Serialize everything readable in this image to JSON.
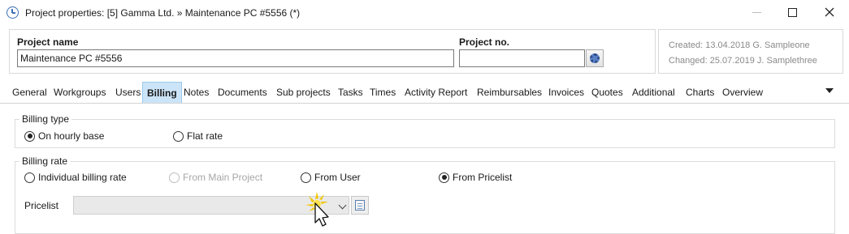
{
  "window": {
    "title": "Project properties: [5] Gamma Ltd. » Maintenance PC #5556 (*)",
    "controls": {
      "minimize": "minimize-icon",
      "maximize": "maximize-icon",
      "close": "close-icon"
    }
  },
  "header": {
    "project_name_label": "Project name",
    "project_name_value": "Maintenance PC #5556",
    "project_no_label": "Project no.",
    "project_no_value": "",
    "created": "Created: 13.04.2018 G. Sampleone",
    "changed": "Changed: 25.07.2019 J. Samplethree"
  },
  "tabs": [
    {
      "label": "General"
    },
    {
      "label": "Workgroups"
    },
    {
      "label": "Users"
    },
    {
      "label": "Billing"
    },
    {
      "label": "Notes"
    },
    {
      "label": "Documents"
    },
    {
      "label": "Sub projects"
    },
    {
      "label": "Tasks"
    },
    {
      "label": "Times"
    },
    {
      "label": "Activity Report"
    },
    {
      "label": "Reimbursables"
    },
    {
      "label": "Invoices"
    },
    {
      "label": "Quotes"
    },
    {
      "label": "Additional"
    },
    {
      "label": "Charts"
    },
    {
      "label": "Overview"
    }
  ],
  "active_tab": "Billing",
  "billing_type": {
    "title": "Billing type",
    "options": [
      {
        "label": "On hourly base",
        "checked": true
      },
      {
        "label": "Flat rate",
        "checked": false
      }
    ]
  },
  "billing_rate": {
    "title": "Billing rate",
    "options": [
      {
        "label": "Individual billing rate",
        "checked": false,
        "enabled": true
      },
      {
        "label": "From Main Project",
        "checked": false,
        "enabled": false
      },
      {
        "label": "From User",
        "checked": false,
        "enabled": true
      },
      {
        "label": "From Pricelist",
        "checked": true,
        "enabled": true
      }
    ],
    "pricelist_label": "Pricelist",
    "pricelist_value": ""
  }
}
